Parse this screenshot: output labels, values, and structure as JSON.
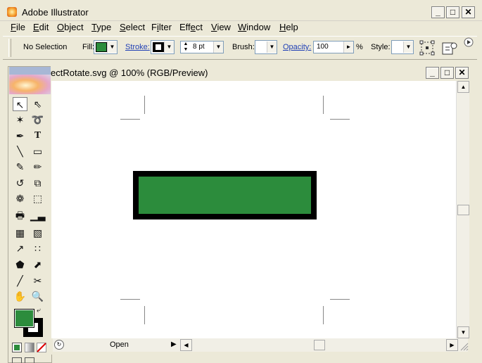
{
  "app": {
    "title": "Adobe Illustrator",
    "window_buttons": {
      "minimize": "_",
      "maximize": "□",
      "close": "✕"
    }
  },
  "menu": {
    "items": [
      {
        "label": "File",
        "ul": "F",
        "rest": "ile"
      },
      {
        "label": "Edit",
        "ul": "E",
        "rest": "dit"
      },
      {
        "label": "Object",
        "ul": "O",
        "rest": "bject"
      },
      {
        "label": "Type",
        "ul": "T",
        "rest": "ype"
      },
      {
        "label": "Select",
        "ul": "S",
        "rest": "elect"
      },
      {
        "label": "Filter",
        "pre": "F",
        "ul": "i",
        "rest": "lter"
      },
      {
        "label": "Effect",
        "pre": "Eff",
        "ul": "e",
        "rest": "ct"
      },
      {
        "label": "View",
        "ul": "V",
        "rest": "iew"
      },
      {
        "label": "Window",
        "ul": "W",
        "rest": "indow"
      },
      {
        "label": "Help",
        "ul": "H",
        "rest": "elp"
      }
    ]
  },
  "control_bar": {
    "selection": "No Selection",
    "fill_label": "Fill:",
    "fill_color": "#2c8c3c",
    "stroke_label": "Stroke:",
    "stroke_color": "#000000",
    "stroke_weight": "8 pt",
    "brush_label": "Brush:",
    "opacity_label": "Opacity:",
    "opacity_value": "100",
    "opacity_unit": "%",
    "style_label": "Style:"
  },
  "document": {
    "title": "ectRotate.svg @ 100% (RGB/Preview)",
    "rect_fill": "#2c8c3c",
    "rect_stroke": "#000000"
  },
  "status": {
    "text": "Open"
  },
  "toolbox": {
    "fill_color": "#2c8c3c",
    "stroke_color": "#000000"
  }
}
